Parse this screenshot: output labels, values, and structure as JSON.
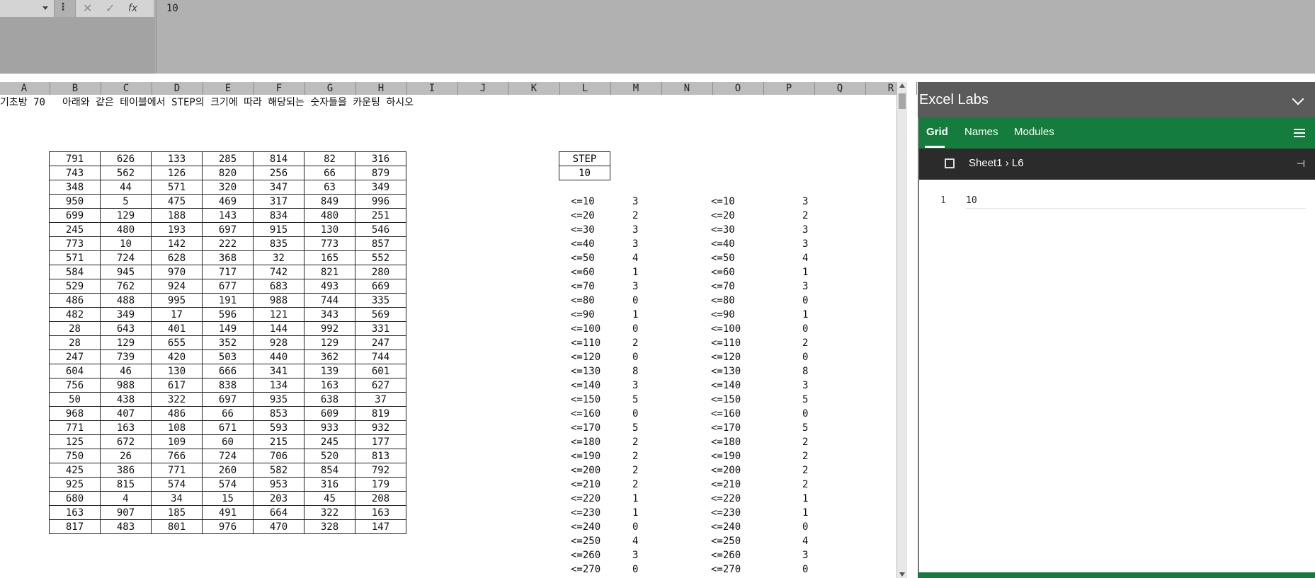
{
  "formula_bar": {
    "value": "10",
    "fx_label": "fx",
    "cancel_glyph": "✕",
    "enter_glyph": "✓"
  },
  "columns": [
    "A",
    "B",
    "C",
    "D",
    "E",
    "F",
    "G",
    "H",
    "I",
    "J",
    "K",
    "L",
    "M",
    "N",
    "O",
    "P",
    "Q",
    "R"
  ],
  "title_cell": {
    "label": "기초방 70",
    "text": "아래와 같은 테이블에서 STEP의 크기에 따라 해당되는 숫자들을 카운팅 하시오"
  },
  "data_table": [
    [
      "791",
      "626",
      "133",
      "285",
      "814",
      "82",
      "316"
    ],
    [
      "743",
      "562",
      "126",
      "820",
      "256",
      "66",
      "879"
    ],
    [
      "348",
      "44",
      "571",
      "320",
      "347",
      "63",
      "349"
    ],
    [
      "950",
      "5",
      "475",
      "469",
      "317",
      "849",
      "996"
    ],
    [
      "699",
      "129",
      "188",
      "143",
      "834",
      "480",
      "251"
    ],
    [
      "245",
      "480",
      "193",
      "697",
      "915",
      "130",
      "546"
    ],
    [
      "773",
      "10",
      "142",
      "222",
      "835",
      "773",
      "857"
    ],
    [
      "571",
      "724",
      "628",
      "368",
      "32",
      "165",
      "552"
    ],
    [
      "584",
      "945",
      "970",
      "717",
      "742",
      "821",
      "280"
    ],
    [
      "529",
      "762",
      "924",
      "677",
      "683",
      "493",
      "669"
    ],
    [
      "486",
      "488",
      "995",
      "191",
      "988",
      "744",
      "335"
    ],
    [
      "482",
      "349",
      "17",
      "596",
      "121",
      "343",
      "569"
    ],
    [
      "28",
      "643",
      "401",
      "149",
      "144",
      "992",
      "331"
    ],
    [
      "28",
      "129",
      "655",
      "352",
      "928",
      "129",
      "247"
    ],
    [
      "247",
      "739",
      "420",
      "503",
      "440",
      "362",
      "744"
    ],
    [
      "604",
      "46",
      "130",
      "666",
      "341",
      "139",
      "601"
    ],
    [
      "756",
      "988",
      "617",
      "838",
      "134",
      "163",
      "627"
    ],
    [
      "50",
      "438",
      "322",
      "697",
      "935",
      "638",
      "37"
    ],
    [
      "968",
      "407",
      "486",
      "66",
      "853",
      "609",
      "819"
    ],
    [
      "771",
      "163",
      "108",
      "671",
      "593",
      "933",
      "932"
    ],
    [
      "125",
      "672",
      "109",
      "60",
      "215",
      "245",
      "177"
    ],
    [
      "750",
      "26",
      "766",
      "724",
      "706",
      "520",
      "813"
    ],
    [
      "425",
      "386",
      "771",
      "260",
      "582",
      "854",
      "792"
    ],
    [
      "925",
      "815",
      "574",
      "574",
      "953",
      "316",
      "179"
    ],
    [
      "680",
      "4",
      "34",
      "15",
      "203",
      "45",
      "208"
    ],
    [
      "163",
      "907",
      "185",
      "491",
      "664",
      "322",
      "163"
    ],
    [
      "817",
      "483",
      "801",
      "976",
      "470",
      "328",
      "147"
    ]
  ],
  "step": {
    "label": "STEP",
    "value": "10"
  },
  "counts": [
    [
      "<=10",
      "3"
    ],
    [
      "<=20",
      "2"
    ],
    [
      "<=30",
      "3"
    ],
    [
      "<=40",
      "3"
    ],
    [
      "<=50",
      "4"
    ],
    [
      "<=60",
      "1"
    ],
    [
      "<=70",
      "3"
    ],
    [
      "<=80",
      "0"
    ],
    [
      "<=90",
      "1"
    ],
    [
      "<=100",
      "0"
    ],
    [
      "<=110",
      "2"
    ],
    [
      "<=120",
      "0"
    ],
    [
      "<=130",
      "8"
    ],
    [
      "<=140",
      "3"
    ],
    [
      "<=150",
      "5"
    ],
    [
      "<=160",
      "0"
    ],
    [
      "<=170",
      "5"
    ],
    [
      "<=180",
      "2"
    ],
    [
      "<=190",
      "2"
    ],
    [
      "<=200",
      "2"
    ],
    [
      "<=210",
      "2"
    ],
    [
      "<=220",
      "1"
    ],
    [
      "<=230",
      "1"
    ],
    [
      "<=240",
      "0"
    ],
    [
      "<=250",
      "4"
    ],
    [
      "<=260",
      "3"
    ],
    [
      "<=270",
      "0"
    ]
  ],
  "panel": {
    "title": "Excel Labs",
    "tabs": [
      "Grid",
      "Names",
      "Modules"
    ],
    "path_sheet": "Sheet1",
    "path_cell": "L6",
    "line_number": "1",
    "code": "10"
  }
}
